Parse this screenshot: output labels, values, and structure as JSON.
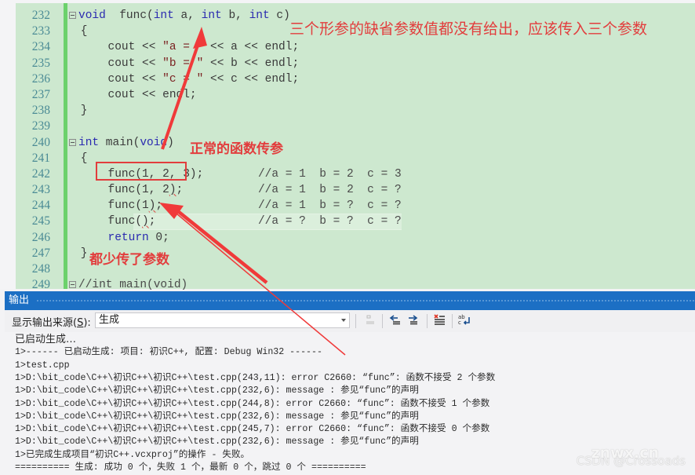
{
  "editor": {
    "lines": [
      {
        "num": "232",
        "fold": true,
        "segments": [
          [
            "kw",
            "void"
          ],
          [
            "",
            "  func("
          ],
          [
            "kw",
            "int"
          ],
          [
            "",
            " a, "
          ],
          [
            "kw",
            "int"
          ],
          [
            "",
            " b, "
          ],
          [
            "kw",
            "int"
          ],
          [
            "",
            " c)"
          ]
        ]
      },
      {
        "num": "233",
        "fold": false,
        "segments": [
          [
            "",
            " {"
          ]
        ]
      },
      {
        "num": "234",
        "fold": false,
        "segments": [
          [
            "",
            "     cout << "
          ],
          [
            "str",
            "\"a = \""
          ],
          [
            "",
            " << a << endl;"
          ]
        ]
      },
      {
        "num": "235",
        "fold": false,
        "segments": [
          [
            "",
            "     cout << "
          ],
          [
            "str",
            "\"b = \""
          ],
          [
            "",
            " << b << endl;"
          ]
        ]
      },
      {
        "num": "236",
        "fold": false,
        "segments": [
          [
            "",
            "     cout << "
          ],
          [
            "str",
            "\"c = \""
          ],
          [
            "",
            " << c << endl;"
          ]
        ]
      },
      {
        "num": "237",
        "fold": false,
        "segments": [
          [
            "",
            "     cout << endl;"
          ]
        ]
      },
      {
        "num": "238",
        "fold": false,
        "segments": [
          [
            "",
            " }"
          ]
        ]
      },
      {
        "num": "239",
        "fold": false,
        "segments": []
      },
      {
        "num": "240",
        "fold": true,
        "segments": [
          [
            "kw",
            "int"
          ],
          [
            "",
            " main("
          ],
          [
            "kw",
            "void"
          ],
          [
            "",
            ")"
          ]
        ]
      },
      {
        "num": "241",
        "fold": false,
        "segments": [
          [
            "",
            " {"
          ]
        ]
      },
      {
        "num": "242",
        "fold": false,
        "segments": [
          [
            "",
            "     func(1, 2, 3);"
          ],
          [
            "cm",
            "        //a = 1  b = 2  c = 3"
          ]
        ]
      },
      {
        "num": "243",
        "fold": false,
        "segments": [
          [
            "",
            "     func(1, 2"
          ],
          [
            "squig",
            ")"
          ],
          [
            "",
            ";"
          ],
          [
            "cm",
            "           //a = 1  b = 2  c = ?"
          ]
        ]
      },
      {
        "num": "244",
        "fold": false,
        "segments": [
          [
            "",
            "     func(1"
          ],
          [
            "squig",
            ")"
          ],
          [
            "",
            ";"
          ],
          [
            "cm",
            "              //a = 1  b = ?  c = ?"
          ]
        ]
      },
      {
        "num": "245",
        "fold": false,
        "current": true,
        "segments": [
          [
            "",
            "     func("
          ],
          [
            "squig",
            ")"
          ],
          [
            "",
            ";"
          ],
          [
            "cm",
            "               //a = ?  b = ?  c = ?"
          ]
        ]
      },
      {
        "num": "246",
        "fold": false,
        "segments": [
          [
            "",
            "     "
          ],
          [
            "kw",
            "return"
          ],
          [
            "",
            " 0;"
          ]
        ]
      },
      {
        "num": "247",
        "fold": false,
        "segments": [
          [
            "",
            " }"
          ]
        ]
      },
      {
        "num": "248",
        "fold": false,
        "segments": []
      },
      {
        "num": "249",
        "fold": true,
        "segments": [
          [
            "cm",
            "//int main(void)"
          ]
        ]
      }
    ],
    "annotations": {
      "top": "三个形参的缺省参数值都没有给出，应该传入三个参数",
      "normal": "正常的函数传参",
      "missing": "都少传了参数"
    }
  },
  "output": {
    "title": "输出",
    "source_label": "显示输出来源(",
    "source_label_key": "S",
    "source_label_end": "):",
    "source_value": "生成",
    "toolbar_icons": [
      "goto-message-icon",
      "previous-message-icon",
      "next-message-icon",
      "clear-all-icon",
      "word-wrap-icon"
    ],
    "lines": [
      "已启动生成…",
      "1>------ 已启动生成: 项目: 初识C++, 配置: Debug Win32 ------",
      "1>test.cpp",
      "1>D:\\bit_code\\C++\\初识C++\\初识C++\\test.cpp(243,11): error C2660: “func”: 函数不接受 2 个参数",
      "1>D:\\bit_code\\C++\\初识C++\\初识C++\\test.cpp(232,6): message : 参见“func”的声明",
      "1>D:\\bit_code\\C++\\初识C++\\初识C++\\test.cpp(244,8): error C2660: “func”: 函数不接受 1 个参数",
      "1>D:\\bit_code\\C++\\初识C++\\初识C++\\test.cpp(232,6): message : 参见“func”的声明",
      "1>D:\\bit_code\\C++\\初识C++\\初识C++\\test.cpp(245,7): error C2660: “func”: 函数不接受 0 个参数",
      "1>D:\\bit_code\\C++\\初识C++\\初识C++\\test.cpp(232,6): message : 参见“func”的声明",
      "1>已完成生成项目“初识C++.vcxproj”的操作 - 失败。",
      "========== 生成: 成功 0 个，失败 1 个，最新 0 个，跳过 0 个 =========="
    ]
  },
  "watermark": {
    "site": "znwx.cn",
    "author": "CSDN @Crossoads"
  },
  "colors": {
    "editor_bg": "#cde8cf",
    "annotation": "#e23d3d",
    "output_title_bg": "#1c6fc4",
    "keyword": "#2a2ab0"
  }
}
